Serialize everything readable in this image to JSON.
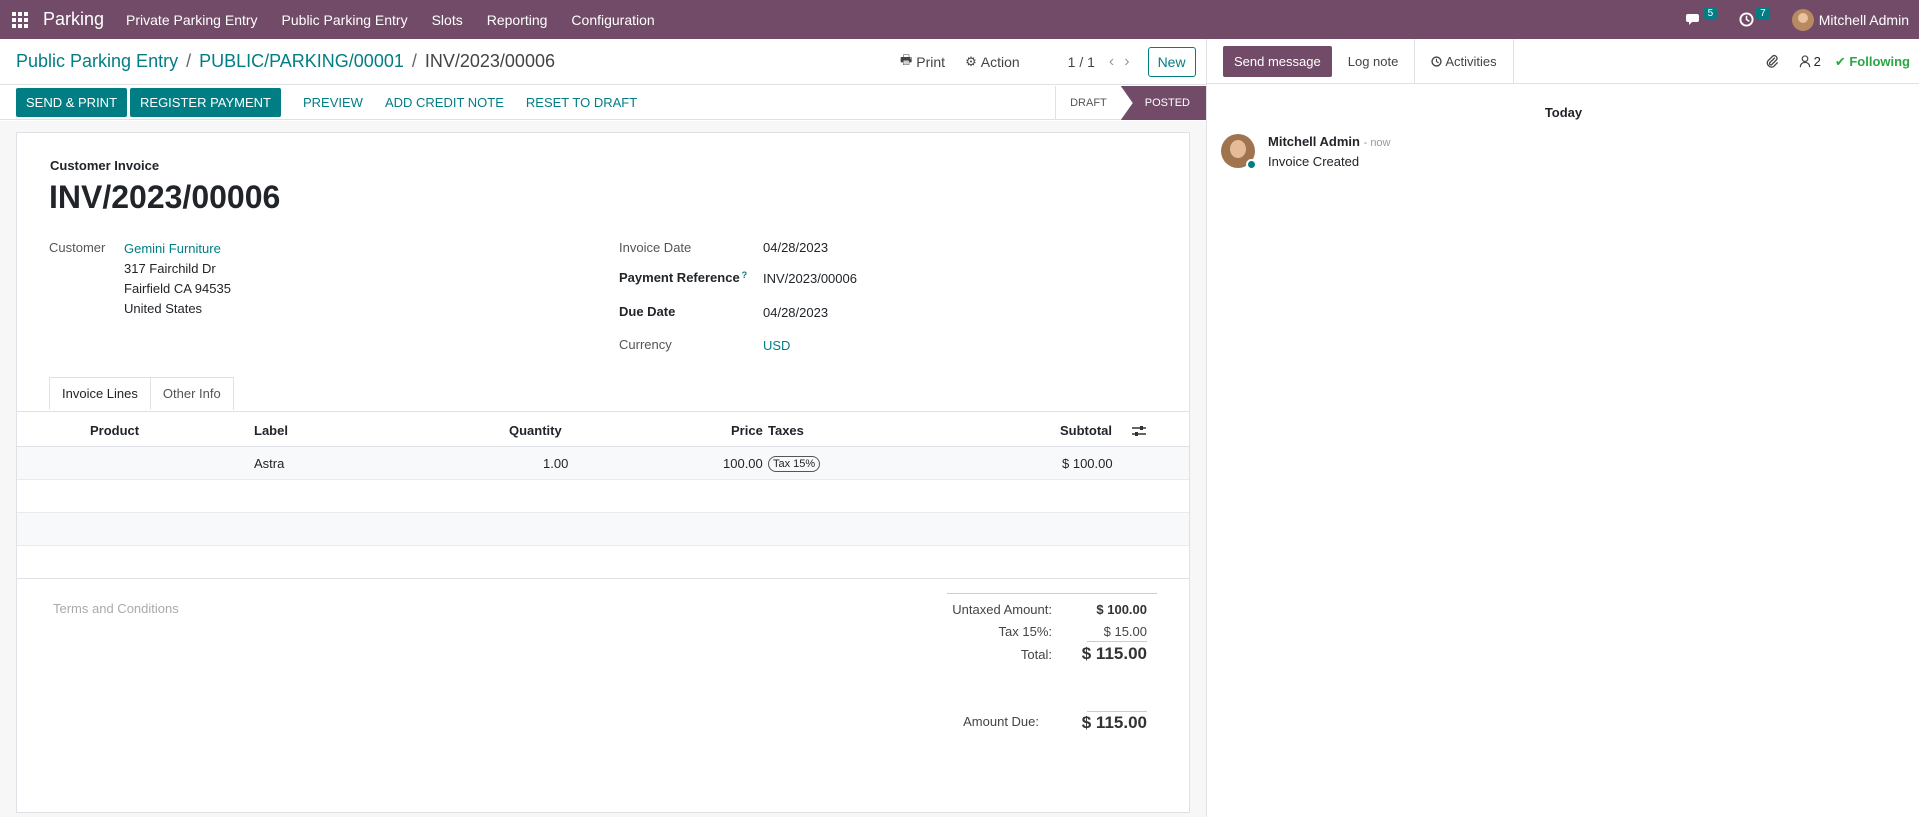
{
  "topbar": {
    "app": "Parking",
    "menu": [
      "Private Parking Entry",
      "Public Parking Entry",
      "Slots",
      "Reporting",
      "Configuration"
    ],
    "messages_count": "5",
    "activities_count": "7",
    "user": "Mitchell Admin"
  },
  "breadcrumb": {
    "root": "Public Parking Entry",
    "parent": "PUBLIC/PARKING/00001",
    "current": "INV/2023/00006"
  },
  "controls": {
    "print": "Print",
    "action": "Action",
    "pager": "1 / 1",
    "new": "New"
  },
  "actions": {
    "send_print": "SEND & PRINT",
    "register_payment": "REGISTER PAYMENT",
    "preview": "PREVIEW",
    "add_credit_note": "ADD CREDIT NOTE",
    "reset_draft": "RESET TO DRAFT"
  },
  "status": {
    "draft": "DRAFT",
    "posted": "POSTED"
  },
  "invoice": {
    "type": "Customer Invoice",
    "name": "INV/2023/00006",
    "customer_label": "Customer",
    "customer": "Gemini Furniture",
    "address": [
      "317 Fairchild Dr",
      "Fairfield CA 94535",
      "United States"
    ],
    "invoice_date_label": "Invoice Date",
    "invoice_date": "04/28/2023",
    "payment_ref_label": "Payment Reference",
    "payment_ref": "INV/2023/00006",
    "due_date_label": "Due Date",
    "due_date": "04/28/2023",
    "currency_label": "Currency",
    "currency": "USD"
  },
  "tabs": [
    "Invoice Lines",
    "Other Info"
  ],
  "table": {
    "headers": [
      "Product",
      "Label",
      "Quantity",
      "Price",
      "Taxes",
      "Subtotal"
    ],
    "rows": [
      {
        "product": "",
        "label": "Astra",
        "quantity": "1.00",
        "price": "100.00",
        "tax": "Tax 15%",
        "subtotal": "$ 100.00"
      }
    ]
  },
  "totals": {
    "terms": "Terms and Conditions",
    "untaxed_label": "Untaxed Amount:",
    "untaxed": "$ 100.00",
    "tax_label": "Tax 15%:",
    "tax": "$ 15.00",
    "total_label": "Total:",
    "total": "$ 115.00",
    "due_label": "Amount Due:",
    "due": "$ 115.00"
  },
  "chatter": {
    "send": "Send message",
    "log": "Log note",
    "activities": "Activities",
    "followers": "2",
    "following": "Following",
    "today": "Today",
    "author": "Mitchell Admin",
    "time": "- now",
    "body": "Invoice Created"
  }
}
